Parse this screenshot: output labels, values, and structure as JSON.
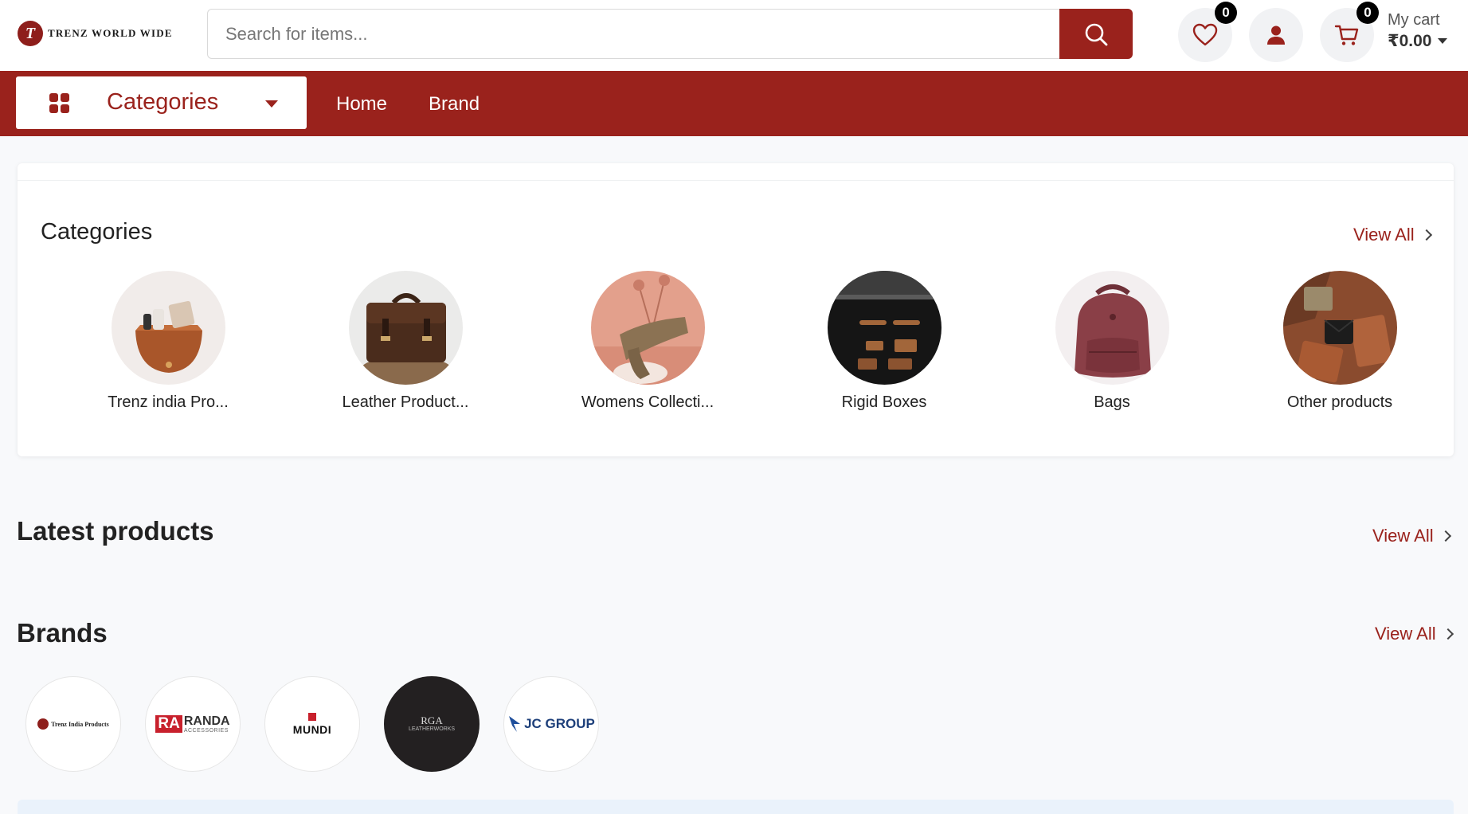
{
  "header": {
    "logo_text": "TRENZ WORLD WIDE",
    "logo_letter": "T",
    "search_placeholder": "Search for items...",
    "wishlist_count": "0",
    "cart_count": "0",
    "cart_label": "My cart",
    "cart_total": "₹0.00"
  },
  "nav": {
    "categories_label": "Categories",
    "links": [
      "Home",
      "Brand"
    ]
  },
  "categories_section": {
    "title": "Categories",
    "view_all": "View All",
    "items": [
      {
        "name": "Trenz india Pro..."
      },
      {
        "name": "Leather Product..."
      },
      {
        "name": "Womens Collecti..."
      },
      {
        "name": "Rigid Boxes"
      },
      {
        "name": "Bags"
      },
      {
        "name": "Other products"
      }
    ]
  },
  "latest_section": {
    "title": "Latest products",
    "view_all": "View All"
  },
  "brands_section": {
    "title": "Brands",
    "view_all": "View All",
    "brands": [
      {
        "name": "Trenz India Products"
      },
      {
        "name": "RANDA",
        "sub": "ACCESSORIES"
      },
      {
        "name": "MUNDI"
      },
      {
        "name": "RGA",
        "sub": "LEATHERWORKS"
      },
      {
        "name": "JC GROUP"
      }
    ]
  },
  "colors": {
    "brand": "#9a221c",
    "page_bg": "#f8f9fb"
  }
}
